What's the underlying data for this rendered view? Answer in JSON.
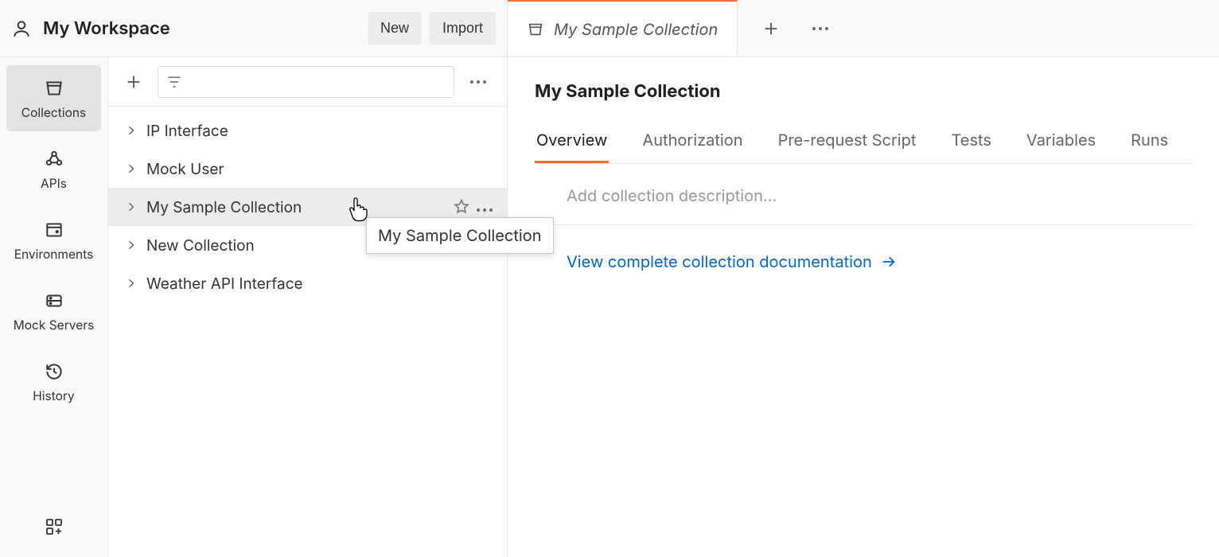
{
  "workspace": {
    "title": "My Workspace"
  },
  "header_buttons": {
    "new": "New",
    "import": "Import"
  },
  "rail": {
    "items": [
      {
        "id": "collections",
        "label": "Collections",
        "selected": true
      },
      {
        "id": "apis",
        "label": "APIs",
        "selected": false
      },
      {
        "id": "environments",
        "label": "Environments",
        "selected": false
      },
      {
        "id": "mock-servers",
        "label": "Mock Servers",
        "selected": false
      },
      {
        "id": "history",
        "label": "History",
        "selected": false
      }
    ]
  },
  "collections": {
    "filter_placeholder": "",
    "items": [
      {
        "name": "IP Interface",
        "selected": false
      },
      {
        "name": "Mock User",
        "selected": false
      },
      {
        "name": "My Sample Collection",
        "selected": true
      },
      {
        "name": "New Collection",
        "selected": false
      },
      {
        "name": "Weather API Interface",
        "selected": false
      }
    ]
  },
  "tooltip": {
    "text": "My Sample Collection"
  },
  "tab": {
    "title": "My Sample Collection"
  },
  "detail": {
    "title": "My Sample Collection",
    "tabs": [
      {
        "label": "Overview",
        "active": true
      },
      {
        "label": "Authorization",
        "active": false
      },
      {
        "label": "Pre-request Script",
        "active": false
      },
      {
        "label": "Tests",
        "active": false
      },
      {
        "label": "Variables",
        "active": false
      },
      {
        "label": "Runs",
        "active": false
      }
    ],
    "description_placeholder": "Add collection description…",
    "doc_link": "View complete collection documentation"
  }
}
